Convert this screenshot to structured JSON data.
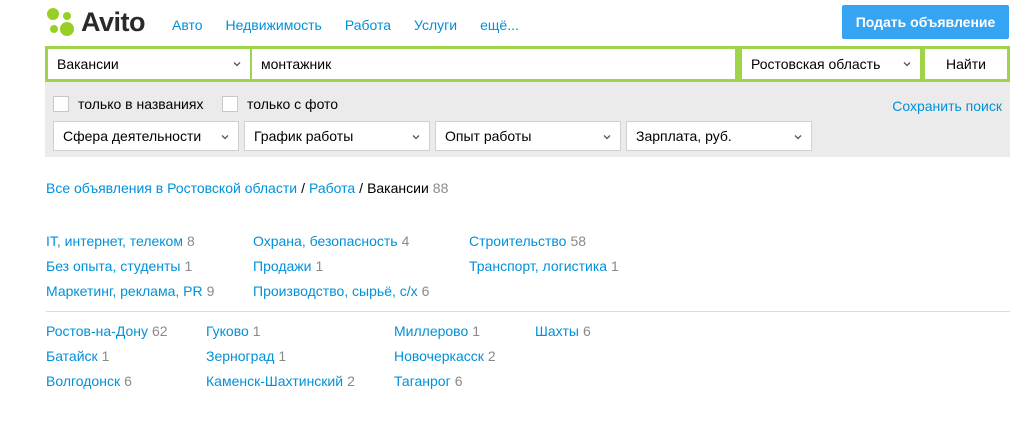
{
  "header": {
    "logo_text": "Avito",
    "nav": [
      "Авто",
      "Недвижимость",
      "Работа",
      "Услуги",
      "ещё..."
    ],
    "post_button": "Подать объявление"
  },
  "search": {
    "category": "Вакансии",
    "query": "монтажник",
    "region": "Ростовская область",
    "find_button": "Найти"
  },
  "filters": {
    "checkbox_titles": "только в названиях",
    "checkbox_photo": "только с фото",
    "save_search": "Сохранить поиск",
    "selects": [
      "Сфера деятельности",
      "График работы",
      "Опыт работы",
      "Зарплата, руб."
    ]
  },
  "breadcrumb": {
    "all": "Все объявления в Ростовской области",
    "work": "Работа",
    "current": "Вакансии",
    "count": "88"
  },
  "categories": [
    [
      {
        "label": "IT, интернет, телеком",
        "count": "8"
      },
      {
        "label": "Без опыта, студенты",
        "count": "1"
      },
      {
        "label": "Маркетинг, реклама, PR",
        "count": "9"
      }
    ],
    [
      {
        "label": "Охрана, безопасность",
        "count": "4"
      },
      {
        "label": "Продажи",
        "count": "1"
      },
      {
        "label": "Производство, сырьё, с/х",
        "count": "6"
      }
    ],
    [
      {
        "label": "Строительство",
        "count": "58"
      },
      {
        "label": "Транспорт, логистика",
        "count": "1"
      }
    ]
  ],
  "cities": [
    [
      {
        "label": "Ростов-на-Дону",
        "count": "62"
      },
      {
        "label": "Батайск",
        "count": "1"
      },
      {
        "label": "Волгодонск",
        "count": "6"
      }
    ],
    [
      {
        "label": "Гуково",
        "count": "1"
      },
      {
        "label": "Зерноград",
        "count": "1"
      },
      {
        "label": "Каменск-Шахтинский",
        "count": "2"
      }
    ],
    [
      {
        "label": "Миллерово",
        "count": "1"
      },
      {
        "label": "Новочеркасск",
        "count": "2"
      },
      {
        "label": "Таганрог",
        "count": "6"
      }
    ],
    [
      {
        "label": "Шахты",
        "count": "6"
      }
    ]
  ],
  "colors": {
    "link": "#0091d9",
    "accent_green": "#9ed44a",
    "post_button": "#35a4f2",
    "logo_dots": [
      "#97cf26",
      "#a169f7",
      "#ff6163",
      "#00aaff"
    ]
  }
}
